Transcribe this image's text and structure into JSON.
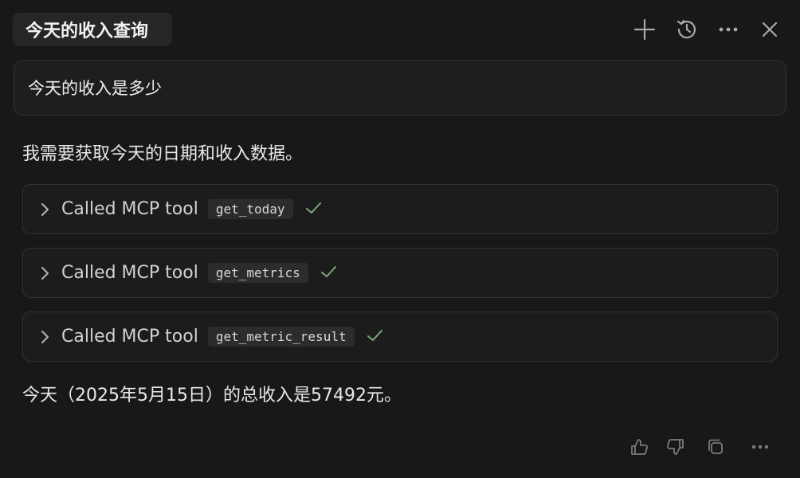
{
  "header": {
    "title": "今天的收入查询",
    "icons": [
      "plus-icon",
      "history-icon",
      "more-icon",
      "close-icon"
    ]
  },
  "user_message": "今天的收入是多少",
  "assistant": {
    "intro": "我需要获取今天的日期和收入数据。",
    "tool_calls": [
      {
        "label": "Called MCP tool",
        "tool": "get_today",
        "status": "success"
      },
      {
        "label": "Called MCP tool",
        "tool": "get_metrics",
        "status": "success"
      },
      {
        "label": "Called MCP tool",
        "tool": "get_metric_result",
        "status": "success"
      }
    ],
    "answer": "今天（2025年5月15日）的总收入是57492元。"
  },
  "footer": {
    "icons": [
      "thumbs-up-icon",
      "thumbs-down-icon",
      "copy-icon",
      "more-icon"
    ]
  },
  "colors": {
    "background": "#181818",
    "check": "#7fa87f"
  }
}
